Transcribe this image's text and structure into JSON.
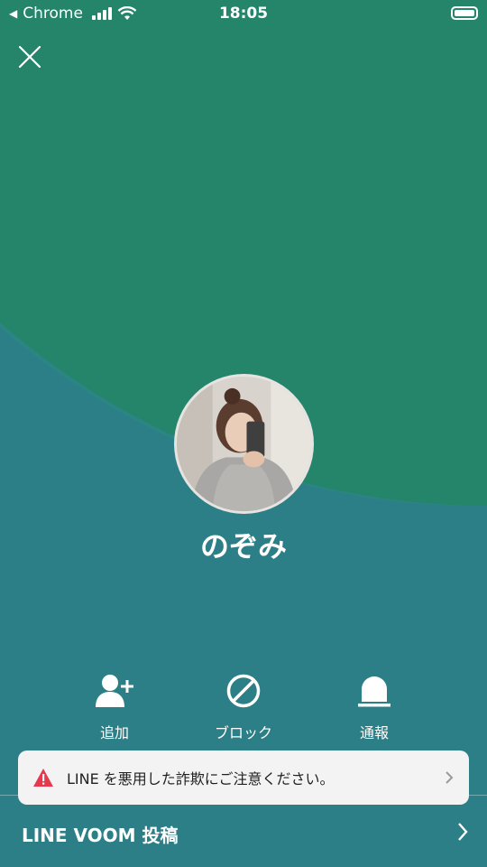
{
  "status_bar": {
    "back_app": "Chrome",
    "time": "18:05"
  },
  "profile": {
    "name": "のぞみ"
  },
  "actions": [
    {
      "label": "追加",
      "icon": "add-friend-icon"
    },
    {
      "label": "ブロック",
      "icon": "block-icon"
    },
    {
      "label": "通報",
      "icon": "report-icon"
    }
  ],
  "notice": {
    "text": "LINE を悪用した詐欺にご注意ください。",
    "icon": "warning-icon"
  },
  "voom": {
    "label": "LINE VOOM 投稿"
  },
  "colors": {
    "header_green": "#24856a",
    "body_teal": "#2c7f86",
    "warning_red": "#e5394d"
  }
}
